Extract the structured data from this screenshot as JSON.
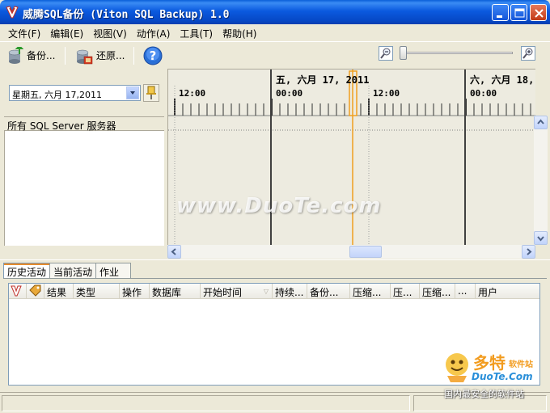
{
  "window": {
    "title": "威腾SQL备份 (Viton SQL Backup) 1.0"
  },
  "menu": {
    "items": [
      "文件(F)",
      "编辑(E)",
      "视图(V)",
      "动作(A)",
      "工具(T)",
      "帮助(H)"
    ]
  },
  "toolbar": {
    "backup_label": "备份...",
    "restore_label": "还原...",
    "icons": [
      "backup-icon",
      "restore-icon",
      "help-icon",
      "zoom-out-icon",
      "zoom-in-icon"
    ]
  },
  "left_panel": {
    "date_value": "星期五, 六月 17,2011",
    "server_header": "所有 SQL Server 服务器"
  },
  "timeline": {
    "day1": "五, 六月 17, 2011",
    "day2": "六, 六月 18,",
    "time_labels": [
      "12:00",
      "00:00",
      "12:00",
      "00:00"
    ],
    "marker_color": "#F0A020"
  },
  "watermark": "www.DuoTe.com",
  "tabs": [
    "历史活动",
    "当前活动",
    "作业"
  ],
  "grid": {
    "columns": [
      "结果",
      "类型",
      "操作",
      "数据库",
      "开始时间",
      "持续...",
      "备份...",
      "压缩...",
      "压...",
      "压缩...",
      "...",
      "用户"
    ]
  },
  "corner_logo": {
    "main": "多特",
    "sub": "软件站",
    "url": "DuoTe.Com",
    "slogan": "国内最安全的软件站"
  }
}
